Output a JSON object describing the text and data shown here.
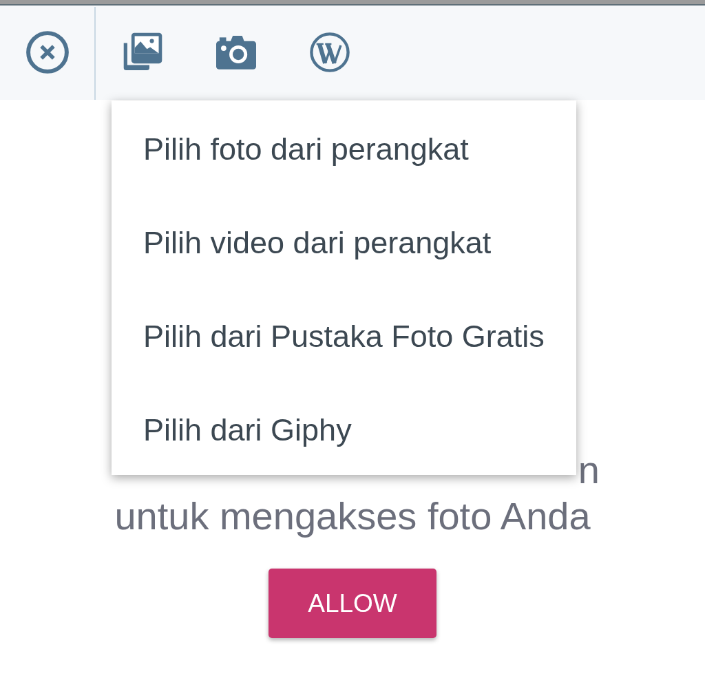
{
  "toolbar": {
    "buttons": [
      {
        "kind": "close"
      },
      {
        "kind": "gallery"
      },
      {
        "kind": "camera"
      },
      {
        "kind": "logo"
      }
    ]
  },
  "menu": {
    "items": [
      "Pilih foto dari perangkat",
      "Pilih video dari perangkat",
      "Pilih dari Pustaka Foto Gratis",
      "Pilih dari Giphy"
    ]
  },
  "permission": {
    "first_line_visible": "n",
    "message": "untuk mengakses foto Anda",
    "button": "ALLOW"
  }
}
